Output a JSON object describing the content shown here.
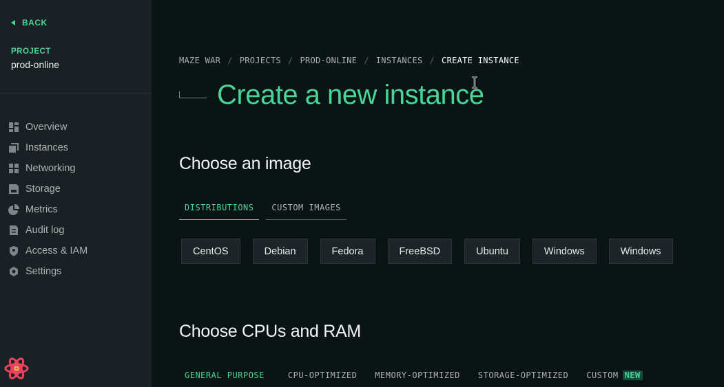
{
  "sidebar": {
    "back_label": "BACK",
    "project_label": "PROJECT",
    "project_name": "prod-online",
    "items": [
      {
        "label": "Overview",
        "icon": "dashboard-icon"
      },
      {
        "label": "Instances",
        "icon": "instances-icon"
      },
      {
        "label": "Networking",
        "icon": "network-icon"
      },
      {
        "label": "Storage",
        "icon": "storage-icon"
      },
      {
        "label": "Metrics",
        "icon": "pie-chart-icon"
      },
      {
        "label": "Audit log",
        "icon": "document-icon"
      },
      {
        "label": "Access & IAM",
        "icon": "shield-icon"
      },
      {
        "label": "Settings",
        "icon": "gear-icon"
      }
    ]
  },
  "breadcrumb": [
    "MAZE WAR",
    "PROJECTS",
    "PROD-ONLINE",
    "INSTANCES",
    "CREATE INSTANCE"
  ],
  "page_title": "Create a new instance",
  "image_section": {
    "title": "Choose an image",
    "tabs": [
      "DISTRIBUTIONS",
      "CUSTOM IMAGES"
    ],
    "active_tab": "DISTRIBUTIONS",
    "images": [
      "CentOS",
      "Debian",
      "Fedora",
      "FreeBSD",
      "Ubuntu",
      "Windows",
      "Windows"
    ]
  },
  "cpu_section": {
    "title": "Choose CPUs and RAM",
    "tabs": [
      "GENERAL PURPOSE",
      "CPU-OPTIMIZED",
      "MEMORY-OPTIMIZED",
      "STORAGE-OPTIMIZED",
      "CUSTOM"
    ],
    "active_tab": "GENERAL PURPOSE",
    "new_badge": "NEW"
  },
  "colors": {
    "accent": "#48d597",
    "sidebar_bg": "#1a2125",
    "main_bg": "#0b1414",
    "button_bg": "#1e2528"
  }
}
